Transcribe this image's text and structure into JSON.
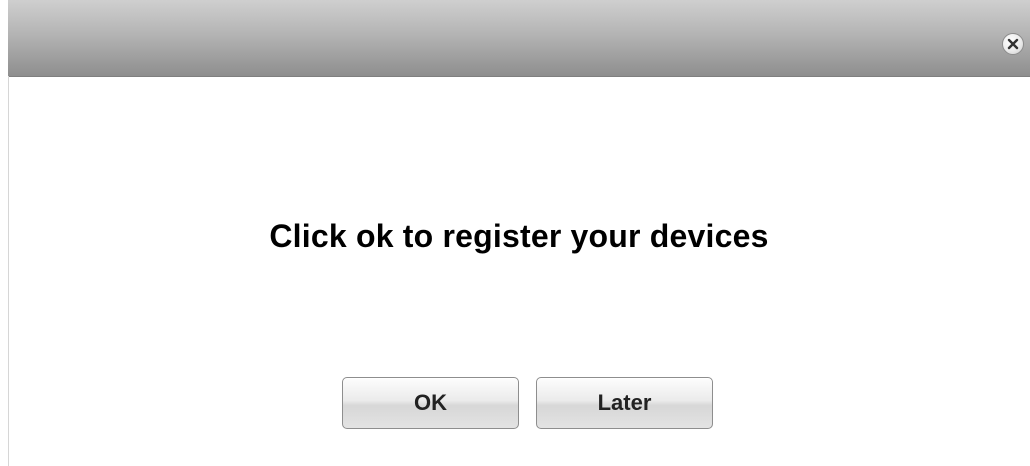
{
  "dialog": {
    "close_icon": "close-icon",
    "message": "Click ok to register your devices",
    "buttons": {
      "ok_label": "OK",
      "later_label": "Later"
    }
  },
  "colors": {
    "titlebar_top": "#cfcfcf",
    "titlebar_bottom": "#8e8e8e",
    "background": "#ffffff",
    "text": "#000000"
  }
}
